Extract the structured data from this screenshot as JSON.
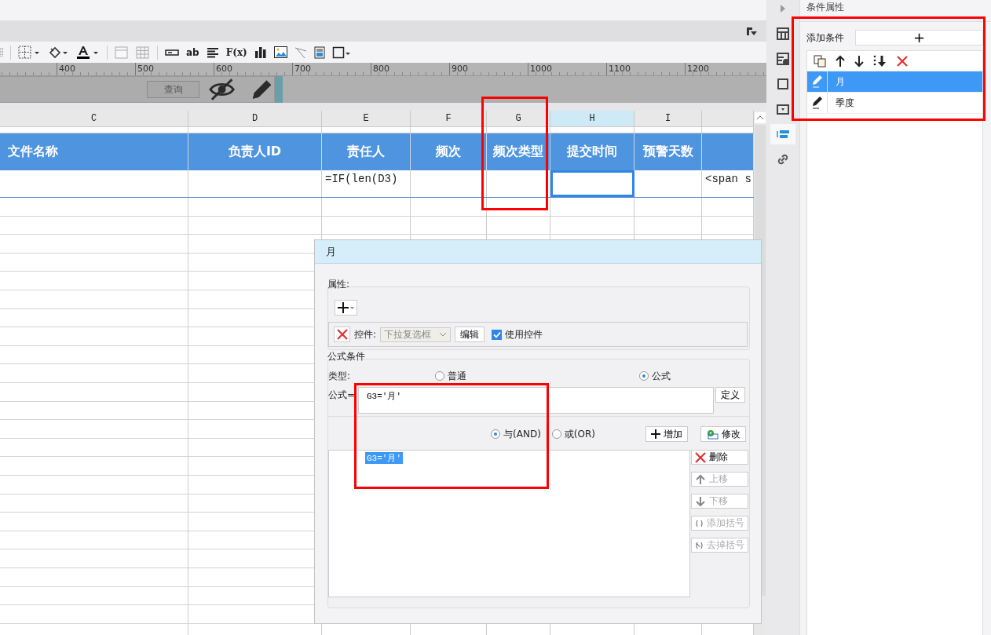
{
  "toolbar": {
    "text_tool": "ab",
    "formula_tool": "F(x)"
  },
  "ruler": {
    "labels": [
      "400",
      "500",
      "600",
      "700",
      "800",
      "900",
      "1000",
      "1100",
      "1200"
    ]
  },
  "parameter_panel": {
    "query_button": "查询"
  },
  "sheet": {
    "columns": [
      {
        "letter": "C",
        "header": "文件名称",
        "selected": false
      },
      {
        "letter": "D",
        "header": "负责人ID",
        "selected": false
      },
      {
        "letter": "E",
        "header": "责任人",
        "cell": "=IF(len(D3)",
        "selected": false
      },
      {
        "letter": "F",
        "header": "频次",
        "selected": false
      },
      {
        "letter": "G",
        "header": "频次类型",
        "selected": false
      },
      {
        "letter": "H",
        "header": "提交时间",
        "selected": true
      },
      {
        "letter": "I",
        "header": "预警天数",
        "selected": false
      },
      {
        "cell": "<span s",
        "selected": false
      }
    ]
  },
  "dialog": {
    "title": "月",
    "properties": {
      "legend": "属性:",
      "control_label": "控件:",
      "control_value": "下拉复选框",
      "edit_button": "编辑",
      "use_control": {
        "label": "使用控件",
        "checked": true
      }
    },
    "formula_condition": {
      "legend": "公式条件",
      "type_label": "类型:",
      "types": [
        {
          "label": "普通",
          "selected": false
        },
        {
          "label": "公式",
          "selected": true
        }
      ],
      "formula_label": "公式=",
      "formula_value": "G3='月'",
      "define_button": "定义",
      "logic": [
        {
          "label": "与(AND)",
          "selected": true
        },
        {
          "label": "或(OR)",
          "selected": false
        }
      ],
      "add_button": "增加",
      "modify_button": "修改",
      "conditions": [
        {
          "text": "G3='月'",
          "selected": true
        }
      ],
      "side_buttons": [
        {
          "kind": "delete",
          "label": "删除",
          "disabled": false
        },
        {
          "kind": "up",
          "label": "上移",
          "disabled": true
        },
        {
          "kind": "down",
          "label": "下移",
          "disabled": true
        },
        {
          "kind": "add-brackets",
          "label": "添加括号",
          "disabled": true
        },
        {
          "kind": "remove-brackets",
          "label": "去掉括号",
          "disabled": true
        }
      ]
    }
  },
  "side_panel": {
    "title": "条件属性",
    "add_label": "添加条件",
    "add_button": "+",
    "tabs": [
      {
        "kind": "layout",
        "selected": false
      },
      {
        "kind": "info",
        "selected": false
      },
      {
        "kind": "frame",
        "selected": false
      },
      {
        "kind": "widget",
        "selected": false
      },
      {
        "kind": "condition",
        "selected": true
      },
      {
        "kind": "link",
        "selected": false
      }
    ],
    "conditions": [
      {
        "name": "月",
        "selected": true
      },
      {
        "name": "季度",
        "selected": false
      }
    ]
  }
}
